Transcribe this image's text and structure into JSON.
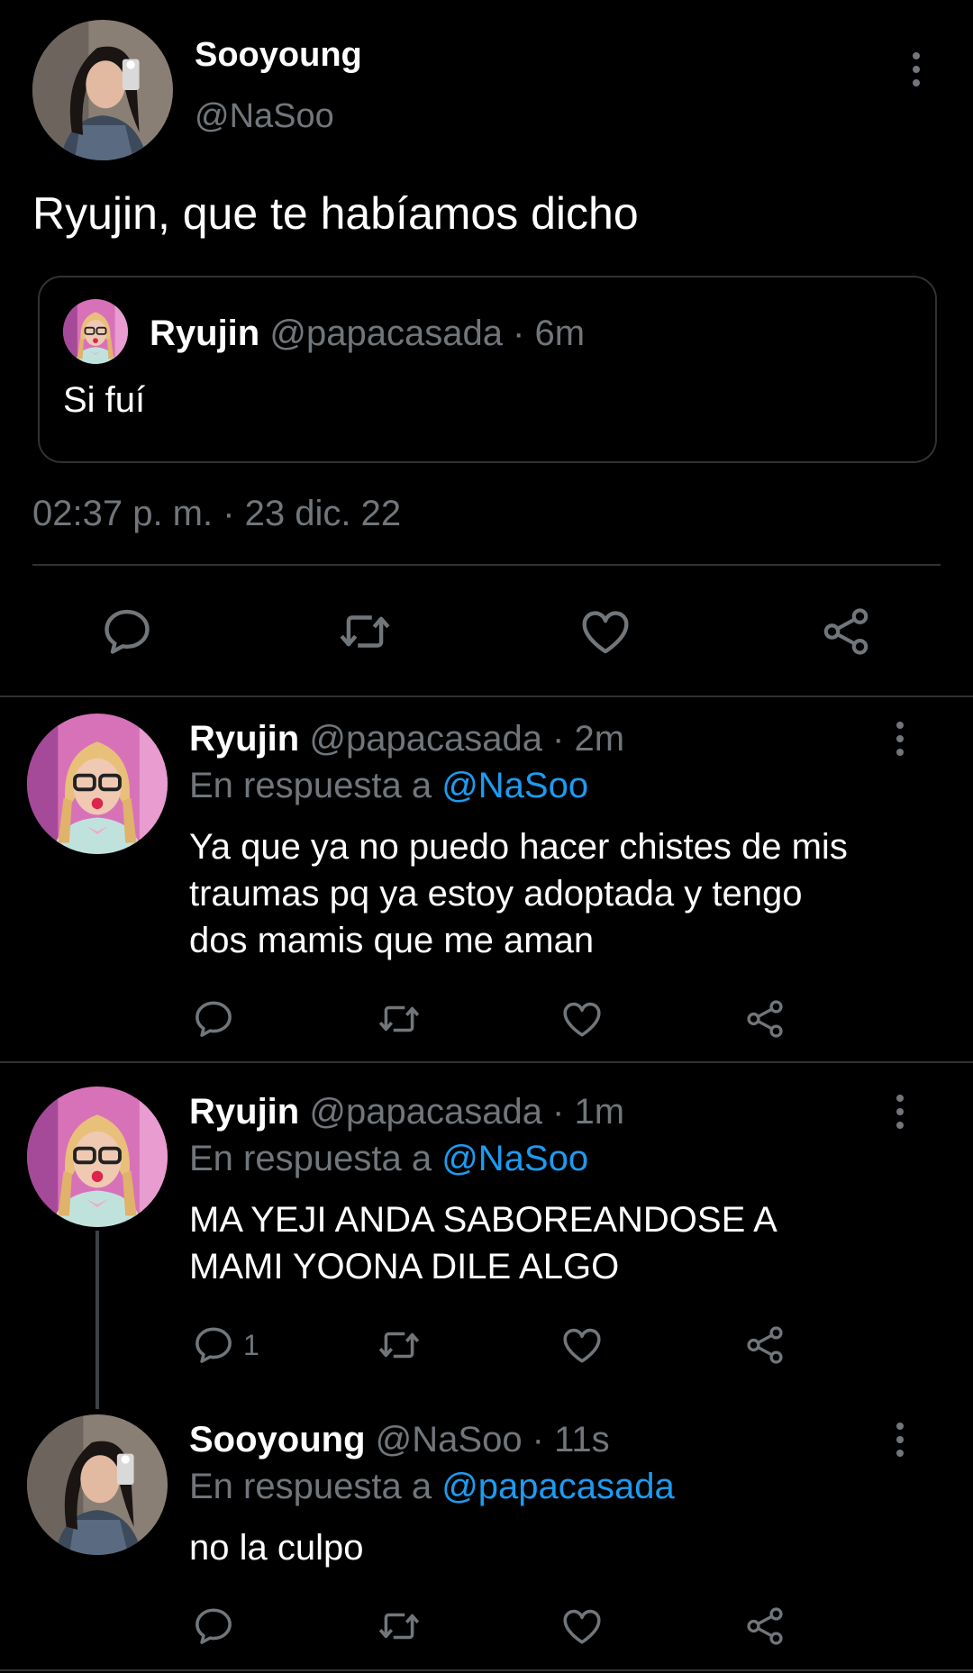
{
  "main_tweet": {
    "display_name": "Sooyoung",
    "handle": "@NaSoo",
    "text": "Ryujin, que te habíamos dicho",
    "quote": {
      "display_name": "Ryujin",
      "meta": "@papacasada · 6m",
      "text": "Si fuí"
    },
    "timestamp": "02:37 p. m. · 23 dic. 22"
  },
  "replies": [
    {
      "display_name": "Ryujin",
      "meta": "@papacasada · 2m",
      "reply_prefix": "En respuesta a",
      "reply_to": "@NaSoo",
      "lines": [
        "Ya que ya no puedo hacer chistes de mis",
        "traumas pq ya estoy adoptada y tengo",
        "dos mamis que me aman"
      ],
      "reply_count": ""
    },
    {
      "display_name": "Ryujin",
      "meta": "@papacasada · 1m",
      "reply_prefix": "En respuesta a",
      "reply_to": "@NaSoo",
      "lines": [
        "MA YEJI ANDA SABOREANDOSE A",
        "MAMI YOONA DILE ALGO"
      ],
      "reply_count": "1"
    },
    {
      "display_name": "Sooyoung",
      "meta": "@NaSoo · 11s",
      "reply_prefix": "En respuesta a",
      "reply_to": "@papacasada",
      "lines": [
        "no la culpo"
      ],
      "reply_count": ""
    }
  ],
  "icons": {
    "reply": "reply-icon",
    "retweet": "retweet-icon",
    "like": "heart-icon",
    "share": "share-icon",
    "more": "more-vertical-icon"
  },
  "colors": {
    "background": "#000000",
    "text": "#e7e9ea",
    "muted": "#71767b",
    "link": "#1d9bf0",
    "divider": "#2f3336"
  }
}
